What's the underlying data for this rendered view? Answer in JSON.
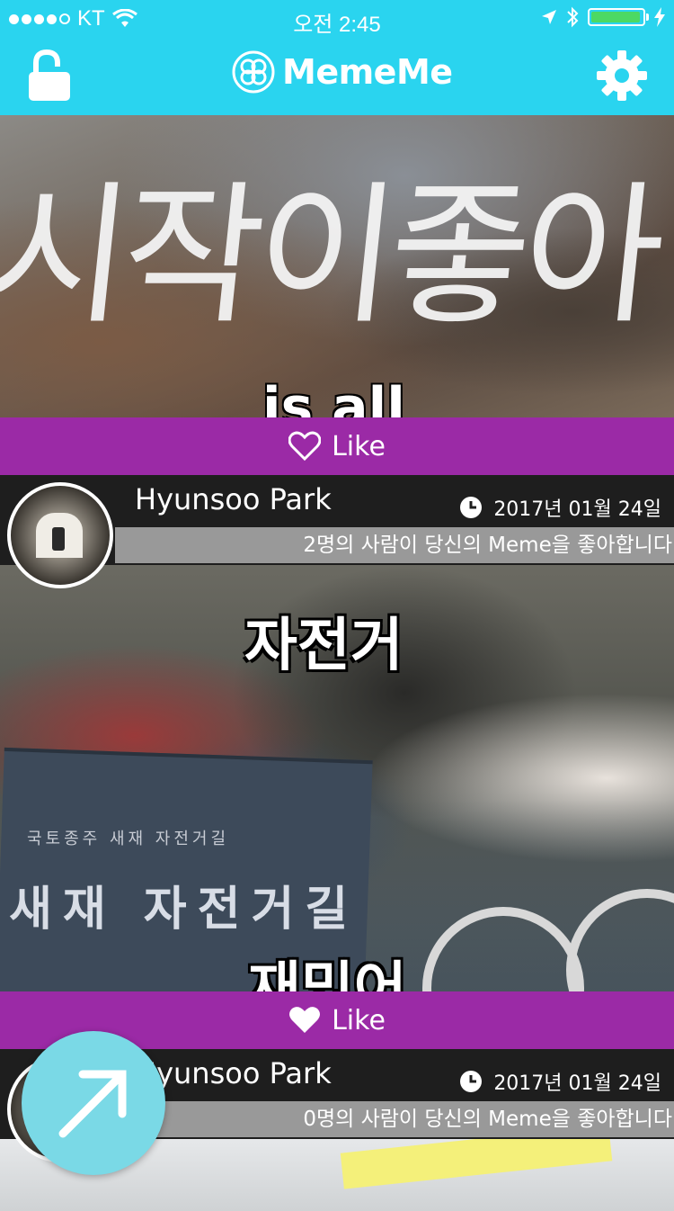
{
  "status_bar": {
    "carrier": "KT",
    "time": "오전 2:45"
  },
  "navbar": {
    "title": "MemeMe",
    "lock_icon": "lock-open-icon",
    "settings_icon": "gear-icon",
    "accent_color": "#2ad4ef"
  },
  "feed": {
    "like_color": "#9b2aa6",
    "posts": [
      {
        "meme_caption_handwritten": "시작이좋아",
        "meme_caption_bottom": "is all",
        "like_label": "Like",
        "liked": false
      },
      {
        "user_name": "Hyunsoo Park",
        "date": "2017년 01월 24일",
        "likes_text": "2명의 사람이 당신의 Meme을 좋아합니다",
        "meme_caption_top": "자전거",
        "meme_caption_bottom": "재밌어",
        "sign_text": "새재 자전거길",
        "sign_small": "국토종주 새재 자전거길",
        "like_label": "Like",
        "liked": true
      },
      {
        "user_name": "Hyunsoo Park",
        "date": "2017년 01월 24일",
        "likes_text": "0명의 사람이 당신의 Meme을 좋아합니다"
      }
    ]
  },
  "fab": {
    "icon": "arrow-up-right-icon",
    "color": "#7ad9e6"
  }
}
